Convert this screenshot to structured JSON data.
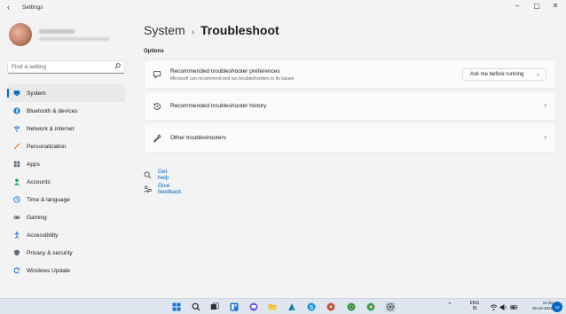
{
  "window": {
    "title": "Settings",
    "back_glyph": "‹",
    "controls": {
      "minimize": "–",
      "maximize": "▢",
      "close": "✕"
    }
  },
  "search": {
    "placeholder": "Find a setting",
    "value": ""
  },
  "sidebar": {
    "items": [
      {
        "label": "System",
        "icon": "system-icon",
        "color": "#0067c0",
        "active": true
      },
      {
        "label": "Bluetooth & devices",
        "icon": "bluetooth-icon",
        "color": "#0a7bd8"
      },
      {
        "label": "Network & internet",
        "icon": "wifi-icon",
        "color": "#2778c4"
      },
      {
        "label": "Personalization",
        "icon": "paintbrush-icon",
        "color": "#e07a1f"
      },
      {
        "label": "Apps",
        "icon": "apps-icon",
        "color": "#5a6a7a"
      },
      {
        "label": "Accounts",
        "icon": "person-icon",
        "color": "#1fa35a"
      },
      {
        "label": "Time & language",
        "icon": "globe-clock-icon",
        "color": "#2a7fd4"
      },
      {
        "label": "Gaming",
        "icon": "gamepad-icon",
        "color": "#6b6b6b"
      },
      {
        "label": "Accessibility",
        "icon": "accessibility-icon",
        "color": "#1f6fd0"
      },
      {
        "label": "Privacy & security",
        "icon": "shield-icon",
        "color": "#5d6a78"
      },
      {
        "label": "Windows Update",
        "icon": "update-icon",
        "color": "#1f6fd0"
      }
    ]
  },
  "main": {
    "breadcrumb_parent": "System",
    "breadcrumb_sep": "›",
    "page_title": "Troubleshoot",
    "section_label": "Options",
    "cards": [
      {
        "title": "Recommended troubleshooter preferences",
        "subtitle": "Microsoft can recommend and run troubleshooters to fix issues",
        "icon": "chat-bubble-icon",
        "dropdown_value": "Ask me before running",
        "dropdown_chevron": "⌄"
      },
      {
        "title": "Recommended troubleshooter history",
        "icon": "history-icon",
        "chevron": "›"
      },
      {
        "title": "Other troubleshooters",
        "icon": "wrench-icon",
        "chevron": "›"
      }
    ],
    "links": [
      {
        "label": "Get help",
        "icon": "help-icon"
      },
      {
        "label": "Give feedback",
        "icon": "feedback-icon"
      }
    ]
  },
  "taskbar": {
    "apps": [
      "start-icon",
      "search-icon",
      "task-view-icon",
      "widgets-icon",
      "chat-icon",
      "file-explorer-icon",
      "edge-icon",
      "store-icon",
      "skype-icon",
      "chrome-icon",
      "chrome-icon-2",
      "chrome-icon-3",
      "settings-icon"
    ],
    "tray": {
      "chevron": "⌃",
      "lang_line1": "ENG",
      "lang_line2": "IN"
    },
    "clock_time": "13:30",
    "clock_date": "25-10-2021",
    "notification_count": "10"
  },
  "colors": {
    "accent": "#0067c0",
    "background": "#f3f3f3",
    "card": "#fbfbfb",
    "taskbar": "#dfe6ef"
  }
}
